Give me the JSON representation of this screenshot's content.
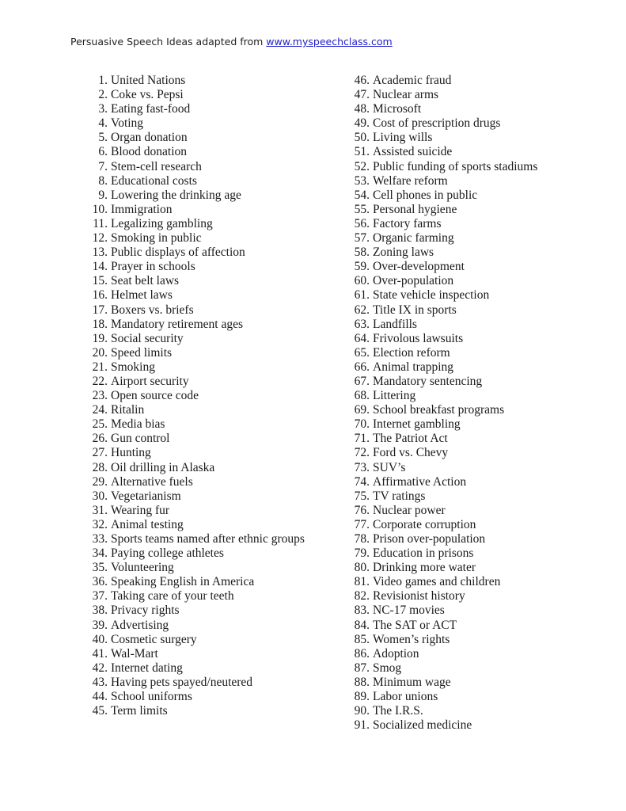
{
  "document": {
    "header": {
      "prefix": "Persuasive Speech Ideas adapted from ",
      "link_text": "www.myspeechclass.com",
      "link_color": "#2121cc"
    },
    "left_column": [
      {
        "num": "1.",
        "text": "United Nations"
      },
      {
        "num": "2.",
        "text": "Coke vs. Pepsi"
      },
      {
        "num": "3.",
        "text": "Eating fast-food"
      },
      {
        "num": "4.",
        "text": "Voting"
      },
      {
        "num": "5.",
        "text": "Organ donation"
      },
      {
        "num": "6.",
        "text": "Blood donation"
      },
      {
        "num": "7.",
        "text": "Stem-cell research"
      },
      {
        "num": "8.",
        "text": "Educational costs"
      },
      {
        "num": "9.",
        "text": "Lowering the drinking age"
      },
      {
        "num": "10.",
        "text": "Immigration"
      },
      {
        "num": "11.",
        "text": "Legalizing gambling"
      },
      {
        "num": "12.",
        "text": "Smoking in public"
      },
      {
        "num": "13.",
        "text": "Public displays of affection"
      },
      {
        "num": "14.",
        "text": "Prayer in schools"
      },
      {
        "num": "15.",
        "text": "Seat belt laws"
      },
      {
        "num": "16.",
        "text": "Helmet laws"
      },
      {
        "num": "17.",
        "text": "Boxers vs. briefs"
      },
      {
        "num": "18.",
        "text": "Mandatory retirement ages"
      },
      {
        "num": "19.",
        "text": "Social security"
      },
      {
        "num": "20.",
        "text": "Speed limits"
      },
      {
        "num": "21.",
        "text": "Smoking"
      },
      {
        "num": "22.",
        "text": "Airport security"
      },
      {
        "num": "23.",
        "text": "Open source code"
      },
      {
        "num": "24.",
        "text": "Ritalin"
      },
      {
        "num": "25.",
        "text": "Media bias"
      },
      {
        "num": "26.",
        "text": "Gun control"
      },
      {
        "num": "27.",
        "text": "Hunting"
      },
      {
        "num": "28.",
        "text": "Oil drilling in Alaska"
      },
      {
        "num": "29.",
        "text": "Alternative fuels"
      },
      {
        "num": "30.",
        "text": "Vegetarianism"
      },
      {
        "num": "31.",
        "text": "Wearing fur"
      },
      {
        "num": "32.",
        "text": "Animal testing"
      },
      {
        "num": "33.",
        "text": "Sports teams named after ethnic groups"
      },
      {
        "num": "34.",
        "text": "Paying college athletes"
      },
      {
        "num": "35.",
        "text": "Volunteering"
      },
      {
        "num": "36.",
        "text": "Speaking English in America"
      },
      {
        "num": "37.",
        "text": "Taking care of your teeth"
      },
      {
        "num": "38.",
        "text": "Privacy rights"
      },
      {
        "num": "39.",
        "text": "Advertising"
      },
      {
        "num": "40.",
        "text": "Cosmetic surgery"
      },
      {
        "num": "41.",
        "text": "Wal-Mart"
      },
      {
        "num": "42.",
        "text": "Internet dating"
      },
      {
        "num": "43.",
        "text": "Having pets spayed/neutered"
      },
      {
        "num": "44.",
        "text": "School uniforms"
      },
      {
        "num": "45.",
        "text": "Term limits"
      }
    ],
    "right_column": [
      {
        "num": "46.",
        "text": "Academic fraud"
      },
      {
        "num": "47.",
        "text": "Nuclear arms"
      },
      {
        "num": "48.",
        "text": "Microsoft"
      },
      {
        "num": "49.",
        "text": "Cost of prescription drugs"
      },
      {
        "num": "50.",
        "text": "Living wills"
      },
      {
        "num": "51.",
        "text": "Assisted suicide"
      },
      {
        "num": "52.",
        "text": "Public funding of sports stadiums"
      },
      {
        "num": "53.",
        "text": "Welfare reform"
      },
      {
        "num": "54.",
        "text": "Cell phones in public"
      },
      {
        "num": "55.",
        "text": "Personal hygiene"
      },
      {
        "num": "56.",
        "text": "Factory farms"
      },
      {
        "num": "57.",
        "text": "Organic farming"
      },
      {
        "num": "58.",
        "text": "Zoning laws"
      },
      {
        "num": "59.",
        "text": "Over-development"
      },
      {
        "num": "60.",
        "text": "Over-population"
      },
      {
        "num": "61.",
        "text": "State vehicle inspection"
      },
      {
        "num": "62.",
        "text": "Title IX in sports"
      },
      {
        "num": "63.",
        "text": "Landfills"
      },
      {
        "num": "64.",
        "text": "Frivolous lawsuits"
      },
      {
        "num": "65.",
        "text": "Election reform"
      },
      {
        "num": "66.",
        "text": "Animal trapping"
      },
      {
        "num": "67.",
        "text": "Mandatory sentencing"
      },
      {
        "num": "68.",
        "text": "Littering"
      },
      {
        "num": "69.",
        "text": "School breakfast programs"
      },
      {
        "num": "70.",
        "text": "Internet gambling"
      },
      {
        "num": "71.",
        "text": "The Patriot Act"
      },
      {
        "num": "72.",
        "text": "Ford vs. Chevy"
      },
      {
        "num": "73.",
        "text": "SUV’s"
      },
      {
        "num": "74.",
        "text": "Affirmative Action"
      },
      {
        "num": "75.",
        "text": "TV ratings"
      },
      {
        "num": "76.",
        "text": "Nuclear power"
      },
      {
        "num": "77.",
        "text": "Corporate corruption"
      },
      {
        "num": "78.",
        "text": "Prison over-population"
      },
      {
        "num": "79.",
        "text": "Education in prisons"
      },
      {
        "num": "80.",
        "text": "Drinking more water"
      },
      {
        "num": "81.",
        "text": "Video games and children"
      },
      {
        "num": "82.",
        "text": "Revisionist history"
      },
      {
        "num": "83.",
        "text": "NC-17 movies"
      },
      {
        "num": "84.",
        "text": "The SAT or ACT"
      },
      {
        "num": "85.",
        "text": "Women’s rights"
      },
      {
        "num": "86.",
        "text": "Adoption"
      },
      {
        "num": "87.",
        "text": "Smog"
      },
      {
        "num": "88.",
        "text": "Minimum wage"
      },
      {
        "num": "89.",
        "text": "Labor unions"
      },
      {
        "num": "90.",
        "text": "The I.R.S."
      },
      {
        "num": "91.",
        "text": "Socialized medicine"
      }
    ]
  }
}
